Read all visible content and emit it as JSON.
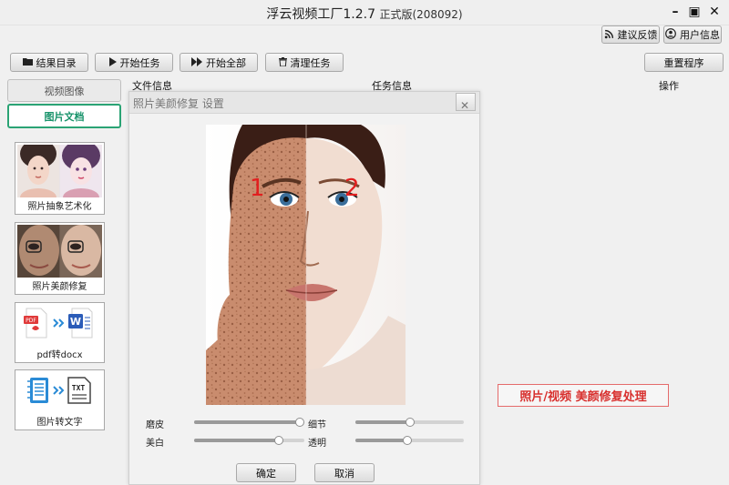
{
  "window": {
    "title": "浮云视频工厂1.2.7",
    "version": "正式版(208092)"
  },
  "header": {
    "feedback_label": "建议反馈",
    "user_label": "用户信息"
  },
  "toolbar": {
    "results_dir_label": "结果目录",
    "start_task_label": "开始任务",
    "start_all_label": "开始全部",
    "clear_tasks_label": "清理任务",
    "reset_label": "重置程序"
  },
  "sidebar": {
    "tabs": [
      {
        "label": "视频图像",
        "active": false
      },
      {
        "label": "图片文档",
        "active": true
      }
    ],
    "tools": [
      {
        "label": "照片抽象艺术化"
      },
      {
        "label": "照片美颜修复"
      },
      {
        "label": "pdf转docx"
      },
      {
        "label": "图片转文字"
      }
    ]
  },
  "columns": {
    "file_info": "文件信息",
    "task_info": "任务信息",
    "actions": "操作"
  },
  "dialog": {
    "title": "照片美颜修复 设置",
    "marks": [
      "1",
      "2"
    ],
    "sliders": [
      {
        "label": "磨皮",
        "value": 1.0
      },
      {
        "label": "细节",
        "value": 0.5
      },
      {
        "label": "美白",
        "value": 0.77
      },
      {
        "label": "透明",
        "value": 0.48
      }
    ],
    "ok_label": "确定",
    "cancel_label": "取消"
  },
  "banner": {
    "text": "照片/视频 美颜修复处理"
  },
  "colors": {
    "accent_green": "#2aa374",
    "banner_red": "#d8302e"
  },
  "icons": [
    "folder-icon",
    "play-icon",
    "fast-forward-icon",
    "trash-icon",
    "rss-icon",
    "user-icon",
    "minimize-icon",
    "maximize-icon",
    "close-icon"
  ]
}
